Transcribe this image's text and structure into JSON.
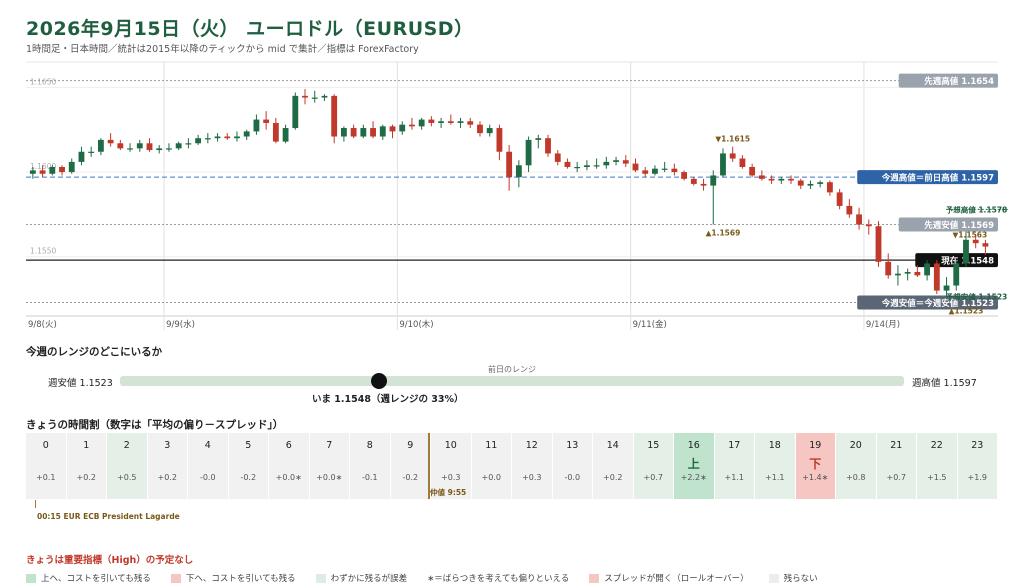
{
  "header": {
    "title": "2026年9月15日（火） ユーロドル（EURUSD）",
    "subtitle": "1時間足・日本時間／統計は2015年以降のティックから mid で集計／指標は ForexFactory"
  },
  "chart_data": {
    "type": "candlestick",
    "ylim": [
      1.1515,
      1.1665
    ],
    "y_ticks": [
      {
        "value": 1.165,
        "label": "1.1650"
      },
      {
        "value": 1.16,
        "label": "1.1600"
      },
      {
        "value": 1.155,
        "label": "1.1550"
      }
    ],
    "day_labels": [
      {
        "label": "9/8(火)",
        "index": 0
      },
      {
        "label": "9/9(水)",
        "index": 14
      },
      {
        "label": "9/10(木)",
        "index": 38
      },
      {
        "label": "9/11(金)",
        "index": 62
      },
      {
        "label": "9/14(月)",
        "index": 86
      },
      {
        "label": "9/",
        "index": 110
      }
    ],
    "candles": [
      [
        1.1599,
        1.1603,
        1.1596,
        1.1601
      ],
      [
        1.1601,
        1.1604,
        1.1597,
        1.1599
      ],
      [
        1.1599,
        1.1604,
        1.1598,
        1.1603
      ],
      [
        1.1603,
        1.1604,
        1.1598,
        1.16
      ],
      [
        1.16,
        1.1608,
        1.1599,
        1.1606
      ],
      [
        1.1606,
        1.1615,
        1.1604,
        1.1612
      ],
      [
        1.1612,
        1.1615,
        1.1609,
        1.1612
      ],
      [
        1.1612,
        1.162,
        1.161,
        1.1619
      ],
      [
        1.1619,
        1.1623,
        1.1615,
        1.1617
      ],
      [
        1.1617,
        1.1619,
        1.1613,
        1.1614
      ],
      [
        1.1614,
        1.1617,
        1.1612,
        1.1614
      ],
      [
        1.1614,
        1.1619,
        1.1612,
        1.1617
      ],
      [
        1.1617,
        1.162,
        1.1612,
        1.1613
      ],
      [
        1.1613,
        1.1616,
        1.1611,
        1.1614
      ],
      [
        1.1614,
        1.1617,
        1.1612,
        1.1614
      ],
      [
        1.1614,
        1.1618,
        1.1613,
        1.1617
      ],
      [
        1.1617,
        1.162,
        1.1614,
        1.1617
      ],
      [
        1.1617,
        1.1622,
        1.1616,
        1.162
      ],
      [
        1.162,
        1.1623,
        1.1617,
        1.162
      ],
      [
        1.162,
        1.1623,
        1.1618,
        1.1621
      ],
      [
        1.1621,
        1.1623,
        1.1619,
        1.162
      ],
      [
        1.162,
        1.1624,
        1.1618,
        1.1621
      ],
      [
        1.1621,
        1.1625,
        1.1619,
        1.1624
      ],
      [
        1.1624,
        1.1634,
        1.1622,
        1.1631
      ],
      [
        1.1631,
        1.1636,
        1.1625,
        1.1629
      ],
      [
        1.1629,
        1.1632,
        1.1617,
        1.1618
      ],
      [
        1.1618,
        1.1628,
        1.1617,
        1.1626
      ],
      [
        1.1626,
        1.1647,
        1.1625,
        1.1645
      ],
      [
        1.1645,
        1.1649,
        1.164,
        1.1644
      ],
      [
        1.1644,
        1.1648,
        1.1641,
        1.1644
      ],
      [
        1.1644,
        1.1646,
        1.1642,
        1.1645
      ],
      [
        1.1645,
        1.1646,
        1.1617,
        1.1621
      ],
      [
        1.1621,
        1.1627,
        1.1618,
        1.1626
      ],
      [
        1.1626,
        1.1628,
        1.162,
        1.1621
      ],
      [
        1.1621,
        1.1628,
        1.162,
        1.1626
      ],
      [
        1.1626,
        1.163,
        1.162,
        1.1621
      ],
      [
        1.1621,
        1.1628,
        1.1619,
        1.1627
      ],
      [
        1.1627,
        1.1628,
        1.162,
        1.1624
      ],
      [
        1.1624,
        1.163,
        1.1622,
        1.1628
      ],
      [
        1.1628,
        1.1632,
        1.1625,
        1.1627
      ],
      [
        1.1627,
        1.1632,
        1.1625,
        1.1631
      ],
      [
        1.1631,
        1.1633,
        1.1627,
        1.1629
      ],
      [
        1.1629,
        1.1632,
        1.1626,
        1.163
      ],
      [
        1.163,
        1.1634,
        1.1628,
        1.1629
      ],
      [
        1.1629,
        1.1632,
        1.1626,
        1.163
      ],
      [
        1.163,
        1.1632,
        1.1626,
        1.1628
      ],
      [
        1.1628,
        1.163,
        1.1621,
        1.1623
      ],
      [
        1.1623,
        1.1628,
        1.1621,
        1.1626
      ],
      [
        1.1626,
        1.1628,
        1.1607,
        1.1612
      ],
      [
        1.1612,
        1.1616,
        1.1589,
        1.1597
      ],
      [
        1.1597,
        1.1607,
        1.1591,
        1.1604
      ],
      [
        1.1604,
        1.1621,
        1.16,
        1.1619
      ],
      [
        1.1619,
        1.1622,
        1.1614,
        1.162
      ],
      [
        1.162,
        1.1622,
        1.1609,
        1.1611
      ],
      [
        1.1611,
        1.1613,
        1.1604,
        1.1606
      ],
      [
        1.1606,
        1.1608,
        1.1602,
        1.1603
      ],
      [
        1.1603,
        1.1606,
        1.16,
        1.1603
      ],
      [
        1.1603,
        1.1607,
        1.1601,
        1.1604
      ],
      [
        1.1604,
        1.1608,
        1.1602,
        1.1604
      ],
      [
        1.1604,
        1.1609,
        1.1602,
        1.1606
      ],
      [
        1.1606,
        1.1609,
        1.1604,
        1.1607
      ],
      [
        1.1607,
        1.161,
        1.1603,
        1.1605
      ],
      [
        1.1605,
        1.1608,
        1.16,
        1.1601
      ],
      [
        1.1601,
        1.1603,
        1.1597,
        1.1599
      ],
      [
        1.1599,
        1.1604,
        1.1598,
        1.1602
      ],
      [
        1.1602,
        1.1606,
        1.16,
        1.1602
      ],
      [
        1.1602,
        1.1605,
        1.1598,
        1.16
      ],
      [
        1.16,
        1.1601,
        1.1595,
        1.1596
      ],
      [
        1.1596,
        1.1597,
        1.1592,
        1.1593
      ],
      [
        1.1593,
        1.1596,
        1.1589,
        1.1592
      ],
      [
        1.1592,
        1.1601,
        1.1569,
        1.1598
      ],
      [
        1.1598,
        1.1614,
        1.1597,
        1.1611
      ],
      [
        1.1611,
        1.1615,
        1.1606,
        1.1608
      ],
      [
        1.1608,
        1.161,
        1.1602,
        1.1603
      ],
      [
        1.1603,
        1.1605,
        1.1597,
        1.1598
      ],
      [
        1.1598,
        1.1601,
        1.1595,
        1.1596
      ],
      [
        1.1596,
        1.1598,
        1.1593,
        1.1595
      ],
      [
        1.1595,
        1.1597,
        1.1593,
        1.1596
      ],
      [
        1.1596,
        1.1598,
        1.1593,
        1.1595
      ],
      [
        1.1595,
        1.1596,
        1.159,
        1.1592
      ],
      [
        1.1592,
        1.1595,
        1.159,
        1.1593
      ],
      [
        1.1593,
        1.1595,
        1.1591,
        1.1594
      ],
      [
        1.1594,
        1.1595,
        1.1586,
        1.1588
      ],
      [
        1.1588,
        1.159,
        1.1578,
        1.158
      ],
      [
        1.158,
        1.1584,
        1.1573,
        1.1575
      ],
      [
        1.1575,
        1.1579,
        1.1566,
        1.1569
      ],
      [
        1.1569,
        1.1572,
        1.1563,
        1.1568
      ],
      [
        1.1568,
        1.1571,
        1.1544,
        1.1547
      ],
      [
        1.1547,
        1.1552,
        1.1537,
        1.1539
      ],
      [
        1.1539,
        1.1545,
        1.1533,
        1.154
      ],
      [
        1.154,
        1.1543,
        1.1536,
        1.1541
      ],
      [
        1.1541,
        1.1545,
        1.1538,
        1.1539
      ],
      [
        1.1539,
        1.1548,
        1.1536,
        1.1546
      ],
      [
        1.1546,
        1.1548,
        1.1528,
        1.153
      ],
      [
        1.153,
        1.1538,
        1.1526,
        1.1533
      ],
      [
        1.1533,
        1.1548,
        1.153,
        1.1546
      ],
      [
        1.1546,
        1.1565,
        1.1544,
        1.156
      ],
      [
        1.156,
        1.1563,
        1.1555,
        1.1558
      ],
      [
        1.1558,
        1.156,
        1.1551,
        1.1556
      ]
    ],
    "levels": [
      {
        "value": 1.1654,
        "label": "先週高値 1.1654",
        "style": "dotted",
        "tag": "gray"
      },
      {
        "value": 1.1597,
        "label": "今週高値＝前日高値 1.1597",
        "style": "dashed",
        "tag": "blue"
      },
      {
        "value": 1.1569,
        "label": "先週安値 1.1569",
        "style": "dotted",
        "tag": "gray"
      },
      {
        "value": 1.1548,
        "label": "現在 1.1548",
        "style": "solid",
        "tag": "black"
      },
      {
        "value": 1.1523,
        "label": "今週安値＝今週安値 1.1523",
        "style": "dotted",
        "tag": "slate"
      }
    ],
    "annotations": [
      {
        "text": "▼1.1615",
        "index": 72,
        "value": 1.1615,
        "pos": "above"
      },
      {
        "text": "▲1.1569",
        "index": 71,
        "value": 1.1569,
        "pos": "below"
      },
      {
        "text": "▼1.1563",
        "index": 94,
        "value": 1.1563,
        "pos": "right"
      },
      {
        "text": "▲1.1523",
        "index": 96,
        "value": 1.1523,
        "pos": "below"
      }
    ],
    "forecast": {
      "high": {
        "value": 1.1578,
        "label": "予想高値 1.1578"
      },
      "low": {
        "value": 1.1523,
        "label": "予想安値 1.1523"
      }
    }
  },
  "weekly_range": {
    "title": "今週のレンジのどこにいるか",
    "low_label": "週安値 1.1523",
    "high_label": "週高値 1.1597",
    "prev_label": "前日のレンジ",
    "now_label": "いま 1.1548（週レンジの 33%）",
    "position_pct": 33
  },
  "hourly": {
    "title": "きょうの時間割（数字は「平均の偏り－スプレッド」）",
    "cells": [
      {
        "hour": "0",
        "value": "+0.1",
        "tone": "plain",
        "arrow": ""
      },
      {
        "hour": "1",
        "value": "+0.2",
        "tone": "plain",
        "arrow": ""
      },
      {
        "hour": "2",
        "value": "+0.5",
        "tone": "light",
        "arrow": ""
      },
      {
        "hour": "3",
        "value": "+0.2",
        "tone": "plain",
        "arrow": ""
      },
      {
        "hour": "4",
        "value": "-0.0",
        "tone": "plain",
        "arrow": ""
      },
      {
        "hour": "5",
        "value": "-0.2",
        "tone": "plain",
        "arrow": ""
      },
      {
        "hour": "6",
        "value": "+0.0∗",
        "tone": "plain",
        "arrow": ""
      },
      {
        "hour": "7",
        "value": "+0.0∗",
        "tone": "plain",
        "arrow": ""
      },
      {
        "hour": "8",
        "value": "-0.1",
        "tone": "plain",
        "arrow": ""
      },
      {
        "hour": "9",
        "value": "-0.2",
        "tone": "plain",
        "arrow": ""
      },
      {
        "hour": "10",
        "value": "+0.3",
        "tone": "plain",
        "arrow": ""
      },
      {
        "hour": "11",
        "value": "+0.0",
        "tone": "plain",
        "arrow": ""
      },
      {
        "hour": "12",
        "value": "+0.3",
        "tone": "plain",
        "arrow": ""
      },
      {
        "hour": "13",
        "value": "-0.0",
        "tone": "plain",
        "arrow": ""
      },
      {
        "hour": "14",
        "value": "+0.2",
        "tone": "plain",
        "arrow": ""
      },
      {
        "hour": "15",
        "value": "+0.7",
        "tone": "light",
        "arrow": ""
      },
      {
        "hour": "16",
        "value": "+2.2∗",
        "tone": "up",
        "arrow": "上"
      },
      {
        "hour": "17",
        "value": "+1.1",
        "tone": "light",
        "arrow": ""
      },
      {
        "hour": "18",
        "value": "+1.1",
        "tone": "light",
        "arrow": ""
      },
      {
        "hour": "19",
        "value": "+1.4∗",
        "tone": "down",
        "arrow": "下"
      },
      {
        "hour": "20",
        "value": "+0.8",
        "tone": "light",
        "arrow": ""
      },
      {
        "hour": "21",
        "value": "+0.7",
        "tone": "light",
        "arrow": ""
      },
      {
        "hour": "22",
        "value": "+1.5",
        "tone": "light",
        "arrow": ""
      },
      {
        "hour": "23",
        "value": "+1.9",
        "tone": "light",
        "arrow": ""
      }
    ],
    "now_label": "仲値 9:55",
    "event_label": "00:15 EUR ECB President Lagarde"
  },
  "notice": "きょうは重要指標（High）の予定なし",
  "legend": [
    {
      "label": "上へ、コストを引いても残る",
      "color": "#bfe3cc"
    },
    {
      "label": "下へ、コストを引いても残る",
      "color": "#f6c6c2"
    },
    {
      "label": "わずかに残るが誤差",
      "color": "#dceee2"
    },
    {
      "label": "∗＝ばらつきを考えても偏りといえる",
      "color": ""
    },
    {
      "label": "スプレッドが開く（ロールオーバー）",
      "color": "#f6c6c2"
    },
    {
      "label": "残らない",
      "color": "#ededed"
    }
  ],
  "colors": {
    "up": "#1f6b45",
    "down": "#c0392b",
    "title": "#1f5f3f"
  }
}
